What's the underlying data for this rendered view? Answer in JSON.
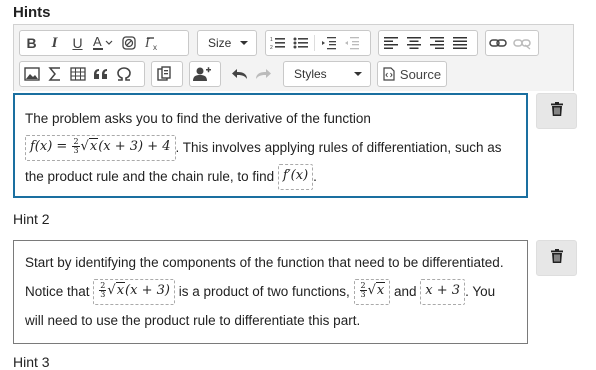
{
  "hints_title": "Hints",
  "toolbar": {
    "bold_label": "B",
    "italic_label": "I",
    "underline_label": "U",
    "size_label": "Size",
    "styles_label": "Styles",
    "source_label": "Source"
  },
  "hint1": {
    "text_before": "The problem asks you to find the derivative of the function ",
    "math1_lhs": "f(x) = ",
    "math1_num": "2",
    "math1_den": "3",
    "math1_rad": "x",
    "math1_rest": "(x + 3) + 4",
    "text_middle": ". This involves applying rules of differentiation, such as the product rule and the chain rule, to find ",
    "math2": "f′(x)",
    "text_end": "."
  },
  "hint2_label": "Hint 2",
  "hint2": {
    "text_before": "Start by identifying the components of the function that need to be differentiated. Notice that ",
    "math1_num": "2",
    "math1_den": "3",
    "math1_rad": "x",
    "math1_rest": "(x + 3)",
    "text_middle": " is a product of two functions, ",
    "math2_num": "2",
    "math2_den": "3",
    "math2_rad": "x",
    "text_and": " and ",
    "math3": "x + 3",
    "text_end": ". You will need to use the product rule to differentiate this part."
  },
  "hint3_label": "Hint 3",
  "icons": [
    "text-color-icon",
    "remove-format-icon",
    "clear-formatting-icon",
    "numbered-list-icon",
    "bulleted-list-icon",
    "decrease-indent-icon",
    "increase-indent-icon",
    "align-left-icon",
    "align-center-icon",
    "align-right-icon",
    "justify-icon",
    "link-icon",
    "unlink-icon",
    "image-icon",
    "sigma-icon",
    "table-icon",
    "blockquote-icon",
    "omega-icon",
    "copy-format-icon",
    "add-user-icon",
    "undo-icon",
    "redo-icon",
    "source-icon",
    "trash-icon"
  ]
}
